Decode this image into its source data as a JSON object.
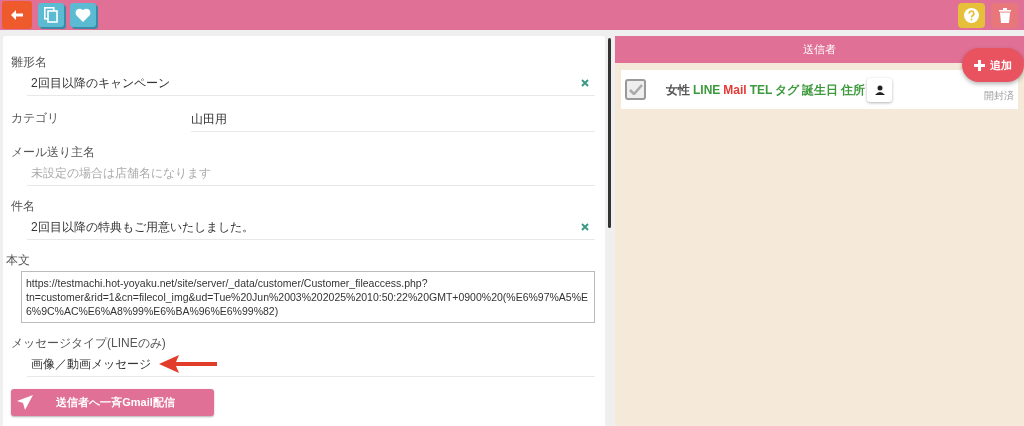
{
  "toolbar": {
    "left_buttons": [
      {
        "kind": "back"
      },
      {
        "kind": "copy"
      },
      {
        "kind": "favorite"
      }
    ],
    "right_buttons": [
      {
        "kind": "help"
      },
      {
        "kind": "delete"
      }
    ]
  },
  "form": {
    "fields": [
      {
        "kind": "input",
        "label": "雛形名",
        "value": "2回目以降のキャンペーン",
        "clearable": true
      },
      {
        "kind": "inline",
        "label": "カテゴリ",
        "value": "山田用"
      },
      {
        "kind": "input",
        "label": "メール送り主名",
        "placeholder": "未設定の場合は店舗名になります"
      },
      {
        "kind": "input",
        "label": "件名",
        "value": "2回目以降の特典もご用意いたしました。",
        "clearable": true
      },
      {
        "kind": "textarea",
        "label": "本文",
        "value": "https://testmachi.hot-yoyaku.net/site/server/_data/customer/Customer_fileaccess.php?tn=customer&rid=1&cn=filecol_img&ud=Tue%20Jun%2003%202025%2010:50:22%20GMT+0900%20(%E6%97%A5%E6%9C%AC%E6%A8%99%E6%BA%96%E6%99%82)"
      },
      {
        "kind": "select",
        "label": "メッセージタイプ(LINEのみ)",
        "value": "画像／動画メッセージ",
        "annotated": true
      }
    ],
    "send_button": "送信者へ一斉Gmail配信"
  },
  "senders": {
    "title": "送信者",
    "add_button": "追加",
    "status": "開封済",
    "rows": [
      {
        "checked": true,
        "tags": [
          {
            "text": "女性",
            "color": "#555555"
          },
          {
            "text": "LINE",
            "color": "#3c9a3c"
          },
          {
            "text": "Mail",
            "color": "#e53935"
          },
          {
            "text": "TEL",
            "color": "#3c9a3c"
          },
          {
            "text": "タグ",
            "color": "#3c9a3c"
          },
          {
            "text": "誕生日",
            "color": "#3c9a3c"
          },
          {
            "text": "住所",
            "color": "#3c9a3c"
          }
        ]
      }
    ]
  }
}
